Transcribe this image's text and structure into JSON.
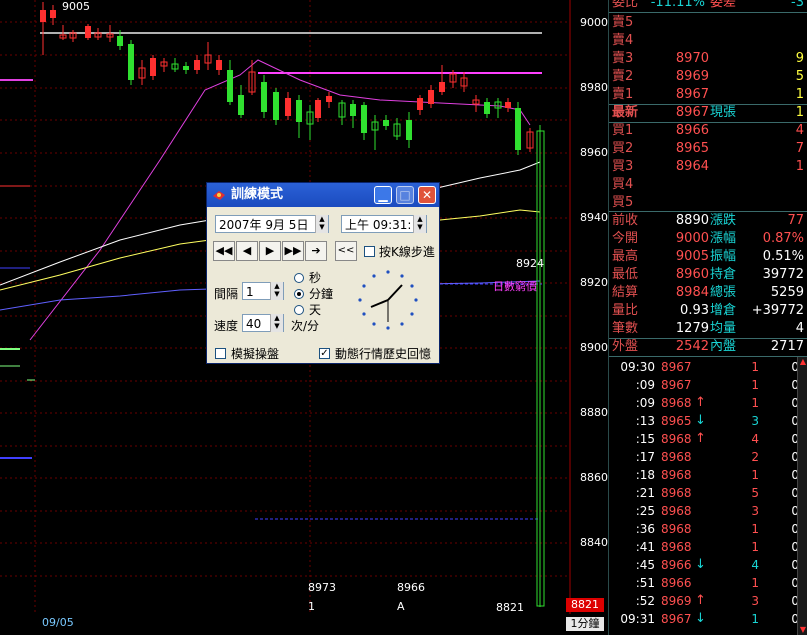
{
  "chart": {
    "y_ticks": [
      "9000",
      "8980",
      "8960",
      "8940",
      "8920",
      "8900",
      "8880",
      "8860",
      "8840"
    ],
    "top_label": "9005",
    "label_8924": "8924",
    "legend_text": "日數窮價",
    "low_label_1": "8973",
    "low_label_2": "8966",
    "low_label_3": "8821",
    "marker_1": "1",
    "marker_2": "A",
    "date": "09/05",
    "period": "1分鐘",
    "price_flag": "8821"
  },
  "panel": {
    "top_row": {
      "label": "委比",
      "value": "-11.11%",
      "label2": "委差",
      "value2": "-3"
    },
    "sell_rows": [
      {
        "label": "賣5",
        "price": "",
        "vol": ""
      },
      {
        "label": "賣4",
        "price": "",
        "vol": ""
      },
      {
        "label": "賣3",
        "price": "8970",
        "vol": "9"
      },
      {
        "label": "賣2",
        "price": "8969",
        "vol": "5"
      },
      {
        "label": "賣1",
        "price": "8967",
        "vol": "1"
      }
    ],
    "latest": {
      "label": "最新",
      "price": "8967",
      "label2": "現張",
      "vol": "1"
    },
    "buy_rows": [
      {
        "label": "買1",
        "price": "8966",
        "vol": "4"
      },
      {
        "label": "買2",
        "price": "8965",
        "vol": "7"
      },
      {
        "label": "買3",
        "price": "8964",
        "vol": "1"
      },
      {
        "label": "買4",
        "price": "",
        "vol": ""
      },
      {
        "label": "買5",
        "price": "",
        "vol": ""
      }
    ],
    "stats": [
      {
        "l1": "前收",
        "v1": "8890",
        "l2": "漲跌",
        "v2": "77"
      },
      {
        "l1": "今開",
        "v1": "9000",
        "l2": "漲幅",
        "v2": "0.87%"
      },
      {
        "l1": "最高",
        "v1": "9005",
        "l2": "振幅",
        "v2": "0.51%"
      },
      {
        "l1": "最低",
        "v1": "8960",
        "l2": "持倉",
        "v2": "39772"
      },
      {
        "l1": "結算",
        "v1": "8984",
        "l2": "總張",
        "v2": "5259"
      },
      {
        "l1": "量比",
        "v1": "0.93",
        "l2": "增倉",
        "v2": "+39772"
      },
      {
        "l1": "筆數",
        "v1": "1279",
        "l2": "均量",
        "v2": "4"
      }
    ],
    "outer": {
      "l1": "外盤",
      "v1": "2542",
      "l2": "內盤",
      "v2": "2717"
    },
    "ticks": [
      {
        "time": "09:30",
        "price": "8967",
        "arrow": "",
        "vol": "1",
        "z": "0"
      },
      {
        "time": ":09",
        "price": "8967",
        "arrow": "",
        "vol": "1",
        "z": "0"
      },
      {
        "time": ":09",
        "price": "8968",
        "arrow": "↑",
        "vol": "1",
        "z": "0"
      },
      {
        "time": ":13",
        "price": "8965",
        "arrow": "↓",
        "vol": "3",
        "z": "0"
      },
      {
        "time": ":15",
        "price": "8968",
        "arrow": "↑",
        "vol": "4",
        "z": "0"
      },
      {
        "time": ":17",
        "price": "8968",
        "arrow": "",
        "vol": "2",
        "z": "0"
      },
      {
        "time": ":18",
        "price": "8968",
        "arrow": "",
        "vol": "1",
        "z": "0"
      },
      {
        "time": ":21",
        "price": "8968",
        "arrow": "",
        "vol": "5",
        "z": "0"
      },
      {
        "time": ":25",
        "price": "8968",
        "arrow": "",
        "vol": "3",
        "z": "0"
      },
      {
        "time": ":36",
        "price": "8968",
        "arrow": "",
        "vol": "1",
        "z": "0"
      },
      {
        "time": ":41",
        "price": "8968",
        "arrow": "",
        "vol": "1",
        "z": "0"
      },
      {
        "time": ":45",
        "price": "8966",
        "arrow": "↓",
        "vol": "4",
        "z": "0"
      },
      {
        "time": ":51",
        "price": "8966",
        "arrow": "",
        "vol": "1",
        "z": "0"
      },
      {
        "time": ":52",
        "price": "8969",
        "arrow": "↑",
        "vol": "3",
        "z": "0"
      },
      {
        "time": "09:31",
        "price": "8967",
        "arrow": "↓",
        "vol": "1",
        "z": "0"
      }
    ]
  },
  "dialog": {
    "title": "訓練模式",
    "date": "2007年 9月 5日",
    "time": "上午 09:31:",
    "kline_step_label": "按K線步進",
    "rewind_label": "<<",
    "interval_label": "間隔",
    "interval_value": "1",
    "unit_sec": "秒",
    "unit_min": "分鐘",
    "unit_day": "天",
    "speed_label": "速度",
    "speed_value": "40",
    "speed_unit": "次/分",
    "simulate_label": "模擬操盤",
    "replay_label": "動態行情歷史回憶",
    "selected_unit": "分鐘",
    "kline_step_checked": false,
    "simulate_checked": false,
    "replay_checked": true
  }
}
